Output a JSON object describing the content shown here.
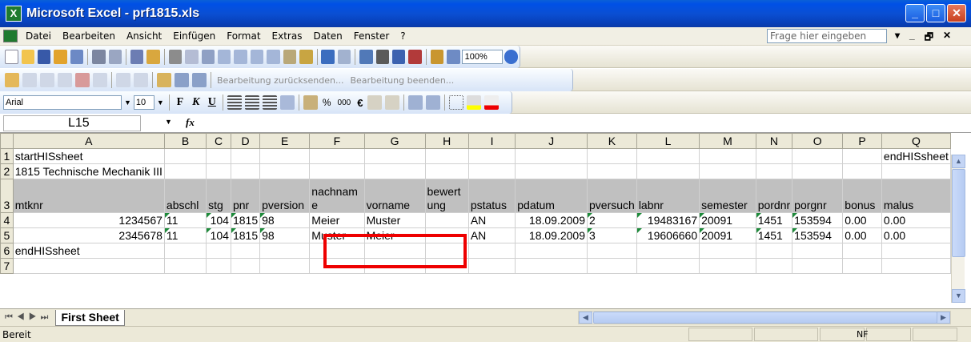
{
  "window": {
    "title": "Microsoft Excel - prf1815.xls",
    "controls": [
      "minimize",
      "maximize",
      "close"
    ]
  },
  "menubar": {
    "items": [
      "Datei",
      "Bearbeiten",
      "Ansicht",
      "Einfügen",
      "Format",
      "Extras",
      "Daten",
      "Fenster",
      "?"
    ],
    "help_placeholder": "Frage hier eingeben"
  },
  "toolbar_standard": {
    "zoom": "100%"
  },
  "toolbar_review": {
    "reply_label": "Bearbeitung zurücksenden...",
    "end_label": "Bearbeitung beenden..."
  },
  "toolbar_format": {
    "font": "Arial",
    "size": "10",
    "bold": "F",
    "italic": "K",
    "underline": "U",
    "percent": "%",
    "thousands": "000",
    "euro": "€"
  },
  "formula_bar": {
    "name_box": "L15",
    "fx": "fx",
    "content": ""
  },
  "columns": [
    "A",
    "B",
    "C",
    "D",
    "E",
    "F",
    "G",
    "H",
    "I",
    "J",
    "K",
    "L",
    "M",
    "N",
    "O",
    "P",
    "Q"
  ],
  "rows": {
    "r1": {
      "num": "1",
      "A": "startHISsheet",
      "Q": "endHISsheet"
    },
    "r2": {
      "num": "2",
      "A": "1815  Technische Mechanik III"
    },
    "r3": {
      "num": "3",
      "A": "mtknr",
      "B": "abschl",
      "C": "stg",
      "D": "pnr",
      "E": "pversion",
      "F": "nachname",
      "G": "vorname",
      "H": "bewertung",
      "I": "pstatus",
      "J": "pdatum",
      "K": "pversuch",
      "L": "labnr",
      "M": "semester",
      "N": "pordnr",
      "O": "porgnr",
      "P": "bonus",
      "Q": "malus"
    },
    "r4": {
      "num": "4",
      "A": "1234567",
      "B": "11",
      "C": "104",
      "D": "1815",
      "E": "98",
      "F": "Meier",
      "G": "Muster",
      "H": "",
      "I": "AN",
      "J": "18.09.2009",
      "K": "2",
      "L": "19483167",
      "M": "20091",
      "N": "1451",
      "O": "153594",
      "P": "0.00",
      "Q": "0.00"
    },
    "r5": {
      "num": "5",
      "A": "2345678",
      "B": "11",
      "C": "104",
      "D": "1815",
      "E": "98",
      "F": "Muster",
      "G": "Meier",
      "H": "",
      "I": "AN",
      "J": "18.09.2009",
      "K": "3",
      "L": "19606660",
      "M": "20091",
      "N": "1451",
      "O": "153594",
      "P": "0.00",
      "Q": "0.00"
    },
    "r6": {
      "num": "6",
      "A": "endHISsheet"
    },
    "r7": {
      "num": "7"
    }
  },
  "sheet_tabs": [
    "First Sheet"
  ],
  "statusbar": {
    "ready": "Bereit",
    "nf": "NF"
  },
  "colors": {
    "titlebar": "#0a4fd3",
    "header_row": "#c0c0c0",
    "highlight": "#ee0000",
    "error_marker": "#1d8a3a"
  }
}
